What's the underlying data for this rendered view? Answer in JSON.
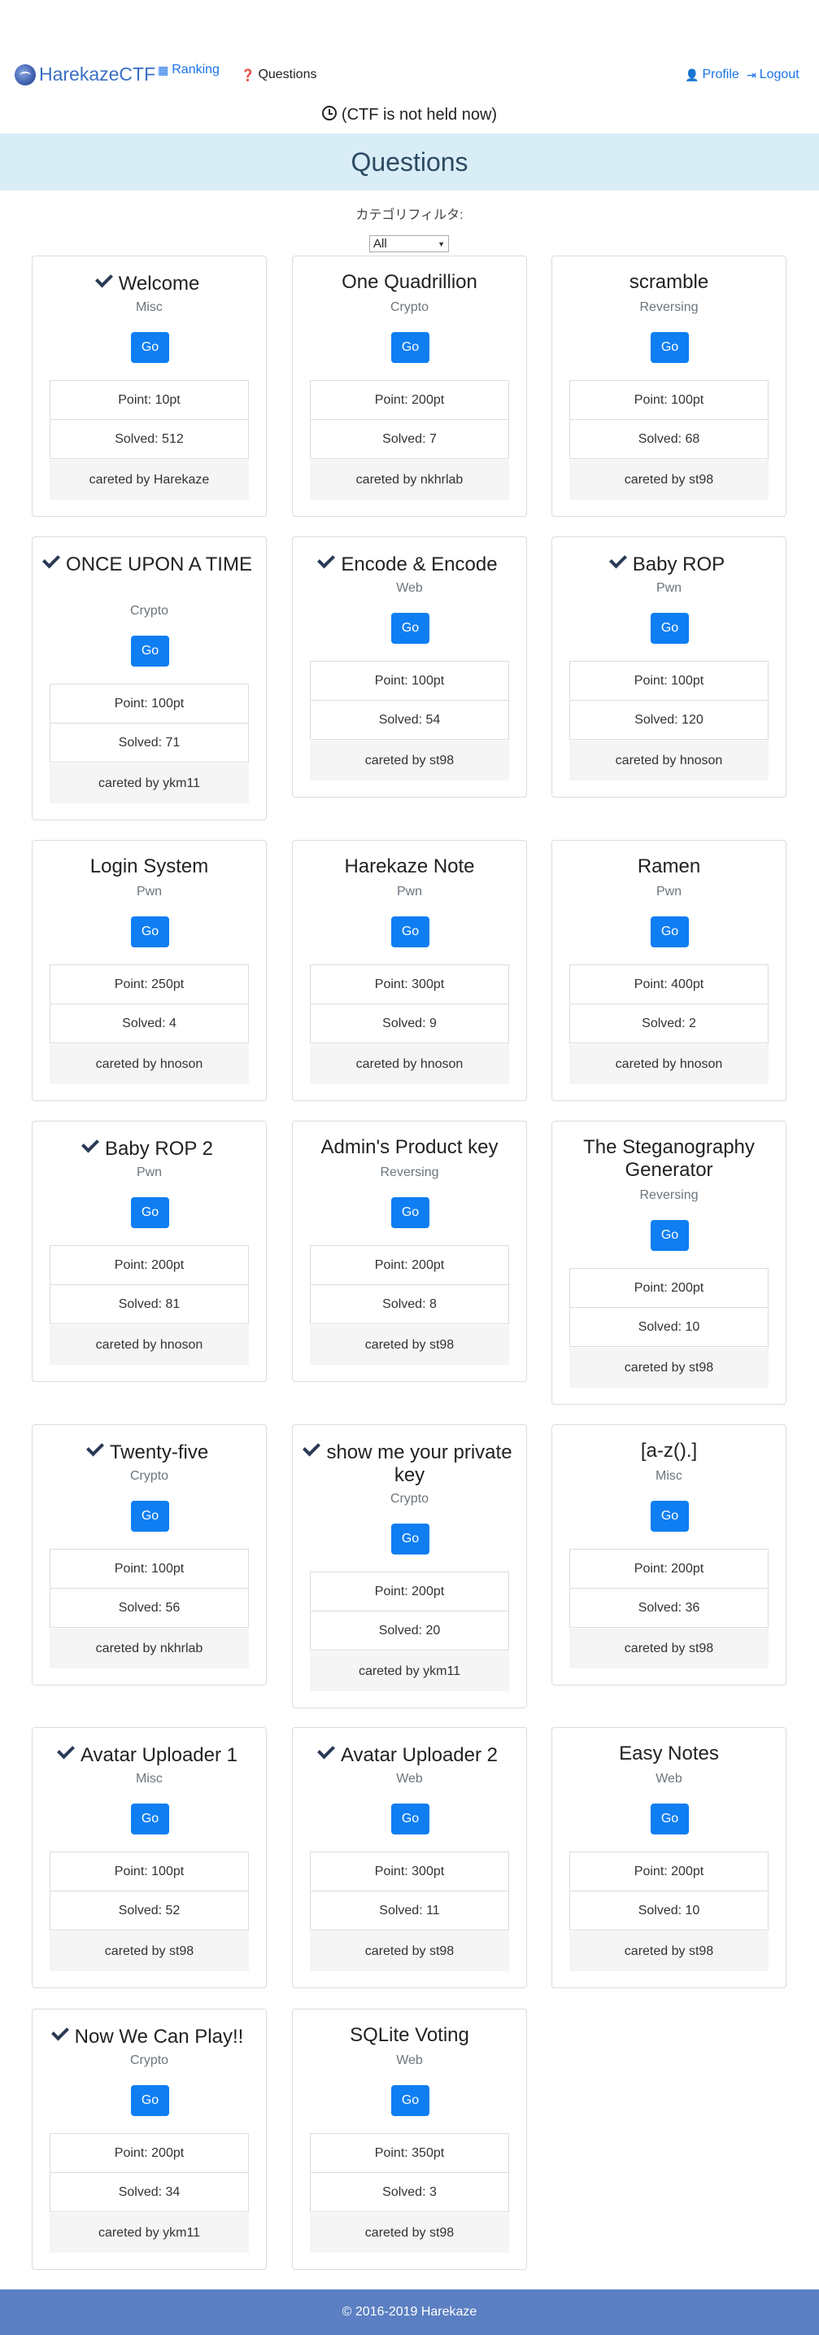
{
  "nav": {
    "brand": "HarekazeCTF",
    "ranking": "Ranking",
    "questions": "Questions",
    "profile": "Profile",
    "logout": "Logout"
  },
  "status": "(CTF is not held now)",
  "page_title": "Questions",
  "filter": {
    "label": "カテゴリフィルタ:",
    "selected": "All"
  },
  "go_label": "Go",
  "footer": "© 2016-2019 Harekaze",
  "questions": [
    {
      "title": "Welcome",
      "category": "Misc",
      "point": "Point: 10pt",
      "solved": "Solved: 512",
      "author": "careted by Harekaze",
      "solved_by_me": true
    },
    {
      "title": "One Quadrillion",
      "category": "Crypto",
      "point": "Point: 200pt",
      "solved": "Solved: 7",
      "author": "careted by nkhrlab",
      "solved_by_me": false
    },
    {
      "title": "scramble",
      "category": "Reversing",
      "point": "Point: 100pt",
      "solved": "Solved: 68",
      "author": "careted by st98",
      "solved_by_me": false
    },
    {
      "title": "ONCE UPON A TIME",
      "category": "Crypto",
      "point": "Point: 100pt",
      "solved": "Solved: 71",
      "author": "careted by ykm11",
      "solved_by_me": true
    },
    {
      "title": "Encode & Encode",
      "category": "Web",
      "point": "Point: 100pt",
      "solved": "Solved: 54",
      "author": "careted by st98",
      "solved_by_me": true
    },
    {
      "title": "Baby ROP",
      "category": "Pwn",
      "point": "Point: 100pt",
      "solved": "Solved: 120",
      "author": "careted by hnoson",
      "solved_by_me": true
    },
    {
      "title": "Login System",
      "category": "Pwn",
      "point": "Point: 250pt",
      "solved": "Solved: 4",
      "author": "careted by hnoson",
      "solved_by_me": false
    },
    {
      "title": "Harekaze Note",
      "category": "Pwn",
      "point": "Point: 300pt",
      "solved": "Solved: 9",
      "author": "careted by hnoson",
      "solved_by_me": false
    },
    {
      "title": "Ramen",
      "category": "Pwn",
      "point": "Point: 400pt",
      "solved": "Solved: 2",
      "author": "careted by hnoson",
      "solved_by_me": false
    },
    {
      "title": "Baby ROP 2",
      "category": "Pwn",
      "point": "Point: 200pt",
      "solved": "Solved: 81",
      "author": "careted by hnoson",
      "solved_by_me": true
    },
    {
      "title": "Admin's Product key",
      "category": "Reversing",
      "point": "Point: 200pt",
      "solved": "Solved: 8",
      "author": "careted by st98",
      "solved_by_me": false
    },
    {
      "title": "The Steganography Generator",
      "category": "Reversing",
      "point": "Point: 200pt",
      "solved": "Solved: 10",
      "author": "careted by st98",
      "solved_by_me": false
    },
    {
      "title": "Twenty-five",
      "category": "Crypto",
      "point": "Point: 100pt",
      "solved": "Solved: 56",
      "author": "careted by nkhrlab",
      "solved_by_me": true
    },
    {
      "title": "show me your private key",
      "category": "Crypto",
      "point": "Point: 200pt",
      "solved": "Solved: 20",
      "author": "careted by ykm11",
      "solved_by_me": true
    },
    {
      "title": "[a-z().]",
      "category": "Misc",
      "point": "Point: 200pt",
      "solved": "Solved: 36",
      "author": "careted by st98",
      "solved_by_me": false
    },
    {
      "title": "Avatar Uploader 1",
      "category": "Misc",
      "point": "Point: 100pt",
      "solved": "Solved: 52",
      "author": "careted by st98",
      "solved_by_me": true
    },
    {
      "title": "Avatar Uploader 2",
      "category": "Web",
      "point": "Point: 300pt",
      "solved": "Solved: 11",
      "author": "careted by st98",
      "solved_by_me": true
    },
    {
      "title": "Easy Notes",
      "category": "Web",
      "point": "Point: 200pt",
      "solved": "Solved: 10",
      "author": "careted by st98",
      "solved_by_me": false
    },
    {
      "title": "Now We Can Play!!",
      "category": "Crypto",
      "point": "Point: 200pt",
      "solved": "Solved: 34",
      "author": "careted by ykm11",
      "solved_by_me": true
    },
    {
      "title": "SQLite Voting",
      "category": "Web",
      "point": "Point: 350pt",
      "solved": "Solved: 3",
      "author": "careted by st98",
      "solved_by_me": false
    }
  ]
}
